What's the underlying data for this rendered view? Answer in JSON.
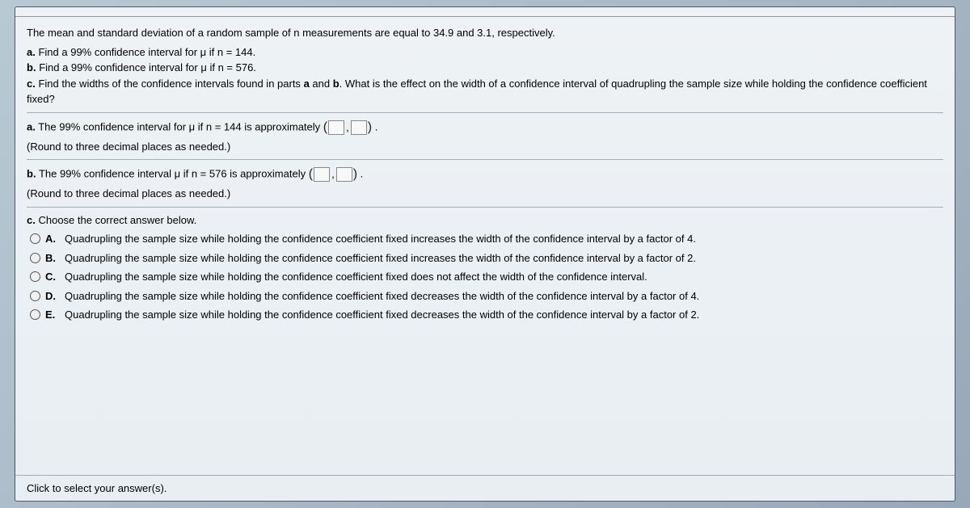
{
  "intro": "The mean and standard deviation of a random sample of n measurements are equal to 34.9 and 3.1, respectively.",
  "parts": {
    "a_prefix": "a.",
    "a_text": "Find a 99% confidence interval for μ if n = 144.",
    "b_prefix": "b.",
    "b_text": "Find a 99% confidence interval for μ if n = 576.",
    "c_prefix": "c.",
    "c_text_1": "Find the widths of the confidence intervals found in parts ",
    "c_bold_a": "a",
    "c_and": " and ",
    "c_bold_b": "b",
    "c_text_2": ". What is the effect on the width of a confidence interval of quadrupling the sample size while holding the confidence coefficient fixed?"
  },
  "answer_a": {
    "prefix": "a.",
    "text": "The 99% confidence interval for μ if n = 144 is approximately",
    "period": ".",
    "hint": "(Round to three decimal places as needed.)"
  },
  "answer_b": {
    "prefix": "b.",
    "text": "The 99% confidence interval μ if n = 576 is approximately",
    "period": ".",
    "hint": "(Round to three decimal places as needed.)"
  },
  "answer_c": {
    "prefix": "c.",
    "text": "Choose the correct answer below."
  },
  "choices": {
    "A": {
      "label": "A.",
      "text": "Quadrupling the sample size while holding the confidence coefficient fixed increases the width of the confidence interval by a factor of 4."
    },
    "B": {
      "label": "B.",
      "text": "Quadrupling the sample size while holding the confidence coefficient fixed increases the width of the confidence interval by a factor of 2."
    },
    "C": {
      "label": "C.",
      "text": "Quadrupling the sample size while holding the confidence coefficient fixed does not affect the width of the confidence interval."
    },
    "D": {
      "label": "D.",
      "text": "Quadrupling the sample size while holding the confidence coefficient fixed decreases the width of the confidence interval by a factor of 4."
    },
    "E": {
      "label": "E.",
      "text": "Quadrupling the sample size while holding the confidence coefficient fixed decreases the width of the confidence interval by a factor of 2."
    }
  },
  "footer": "Click to select your answer(s)."
}
